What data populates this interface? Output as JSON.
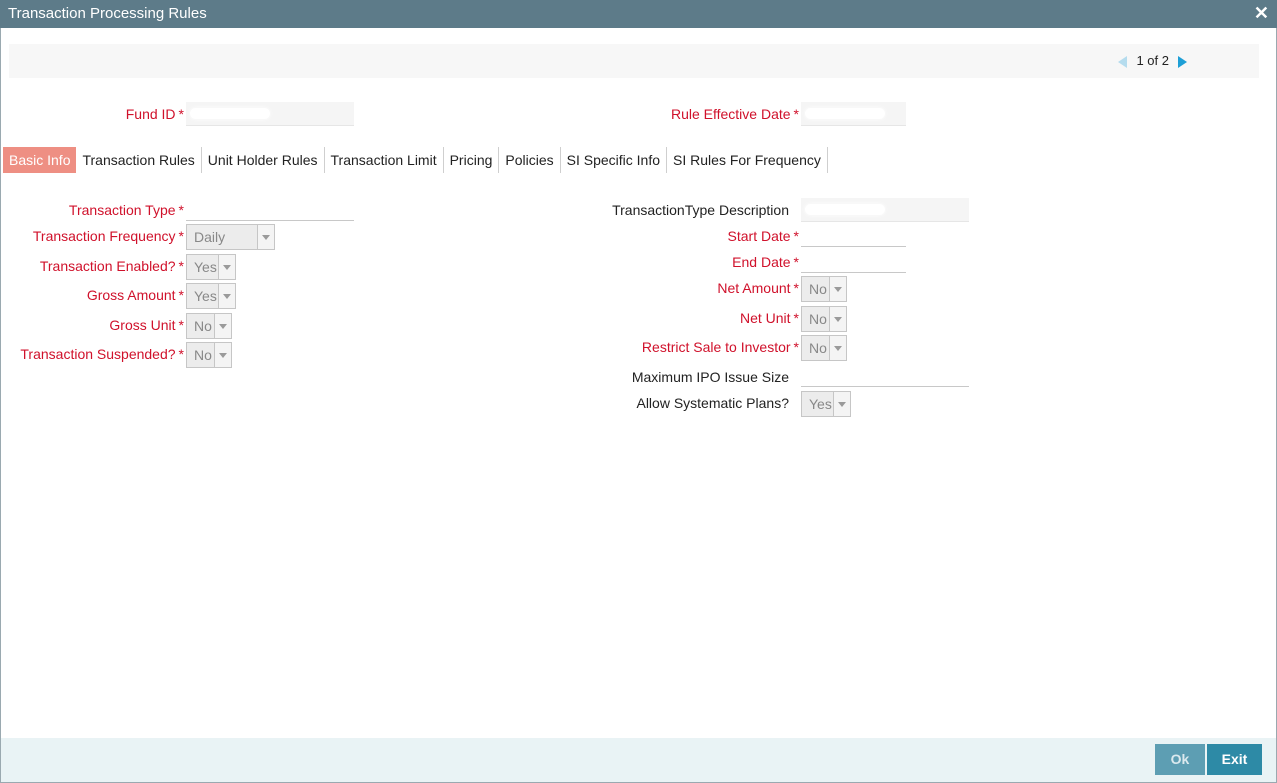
{
  "window": {
    "title": "Transaction Processing Rules",
    "close_label": "✕"
  },
  "pager": {
    "text": "1 of 2"
  },
  "header": {
    "fund_id_label": "Fund ID",
    "rule_effective_date_label": "Rule Effective Date",
    "required_marker": "*"
  },
  "tabs": [
    {
      "label": "Basic Info",
      "active": true
    },
    {
      "label": "Transaction Rules"
    },
    {
      "label": "Unit Holder Rules"
    },
    {
      "label": "Transaction Limit"
    },
    {
      "label": "Pricing"
    },
    {
      "label": "Policies"
    },
    {
      "label": "SI Specific Info"
    },
    {
      "label": "SI Rules For Frequency"
    }
  ],
  "left_form": {
    "transaction_type_label": "Transaction Type",
    "transaction_frequency_label": "Transaction Frequency",
    "transaction_frequency_value": "Daily",
    "transaction_enabled_label": "Transaction Enabled?",
    "transaction_enabled_value": "Yes",
    "gross_amount_label": "Gross Amount",
    "gross_amount_value": "Yes",
    "gross_unit_label": "Gross Unit",
    "gross_unit_value": "No",
    "transaction_suspended_label": "Transaction Suspended?",
    "transaction_suspended_value": "No"
  },
  "right_form": {
    "transaction_type_description_label": "TransactionType Description",
    "start_date_label": "Start Date",
    "end_date_label": "End Date",
    "net_amount_label": "Net Amount",
    "net_amount_value": "No",
    "net_unit_label": "Net Unit",
    "net_unit_value": "No",
    "restrict_sale_label": "Restrict Sale to Investor",
    "restrict_sale_value": "No",
    "max_ipo_label": "Maximum IPO Issue Size",
    "allow_systematic_label": "Allow Systematic Plans?",
    "allow_systematic_value": "Yes"
  },
  "footer": {
    "ok_label": "Ok",
    "exit_label": "Exit"
  },
  "colors": {
    "titlebar": "#5d7b89",
    "required": "#d0112b",
    "active_tab": "#ee8f83",
    "exit_button": "#2d8aa6"
  }
}
